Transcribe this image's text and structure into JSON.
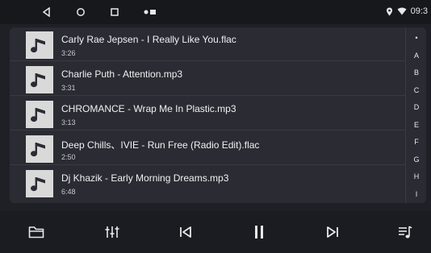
{
  "status_bar": {
    "nav_icons": [
      "back-triangle-icon",
      "home-circle-icon",
      "recents-square-icon",
      "notification-dots-icon"
    ],
    "status_icons": [
      "location-icon",
      "wifi-icon"
    ],
    "time": "09:3"
  },
  "songs": [
    {
      "title": "Carly Rae Jepsen - I Really Like You.flac",
      "duration": "3:26"
    },
    {
      "title": "Charlie Puth - Attention.mp3",
      "duration": "3:31"
    },
    {
      "title": "CHROMANCE - Wrap Me In Plastic.mp3",
      "duration": "3:13"
    },
    {
      "title": "Deep Chills、IVIE - Run Free (Radio Edit).flac",
      "duration": "2:50"
    },
    {
      "title": "Dj Khazik - Early Morning Dreams.mp3",
      "duration": "6:48"
    }
  ],
  "alphabet_index": [
    "•",
    "A",
    "B",
    "C",
    "D",
    "E",
    "F",
    "G",
    "H",
    "I"
  ],
  "controls": [
    {
      "name": "folder-icon"
    },
    {
      "name": "equalizer-icon"
    },
    {
      "name": "previous-track-icon"
    },
    {
      "name": "pause-icon"
    },
    {
      "name": "next-track-icon"
    },
    {
      "name": "playlist-icon"
    }
  ],
  "colors": {
    "background": "#1f2026",
    "panel": "#2b2c33",
    "status_bar": "#17181c",
    "control_bar": "#1b1c21",
    "icon_tile": "#d9d9d9",
    "text": "#f0f0f2"
  }
}
